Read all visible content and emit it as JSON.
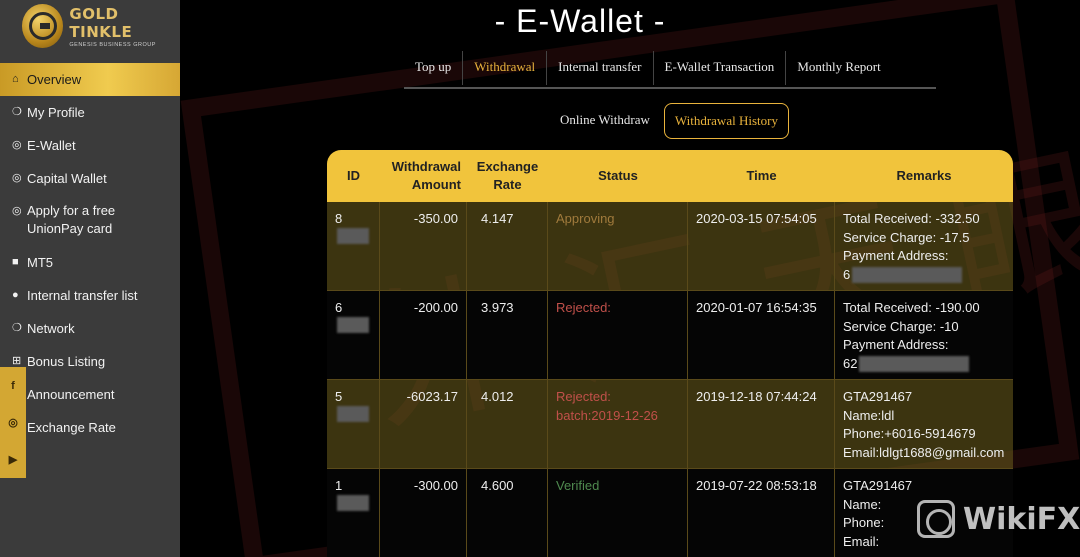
{
  "brand": {
    "name": "GOLD TINKLE",
    "tagline": "GENESIS BUSINESS GROUP"
  },
  "sidebar": {
    "items": [
      {
        "icon": "home-icon",
        "glyph": "⌂",
        "label": "Overview",
        "active": true
      },
      {
        "icon": "profile-icon",
        "glyph": "❍",
        "label": "My Profile"
      },
      {
        "icon": "wallet-icon",
        "glyph": "◎",
        "label": "E-Wallet"
      },
      {
        "icon": "capital-icon",
        "glyph": "◎",
        "label": "Capital Wallet"
      },
      {
        "icon": "card-icon",
        "glyph": "◎",
        "label": "Apply for a free UnionPay card"
      },
      {
        "icon": "mt5-icon",
        "glyph": "■",
        "label": "MT5"
      },
      {
        "icon": "transfer-icon",
        "glyph": "●",
        "label": "Internal transfer list"
      },
      {
        "icon": "network-icon",
        "glyph": "❍",
        "label": "Network"
      },
      {
        "icon": "bonus-icon",
        "glyph": "⊞",
        "label": "Bonus Listing"
      },
      {
        "icon": "announcement-icon",
        "glyph": "",
        "label": "Announcement"
      },
      {
        "icon": "exchange-icon",
        "glyph": "",
        "label": "Exchange Rate"
      }
    ],
    "social": [
      {
        "icon": "facebook-icon",
        "glyph": "f"
      },
      {
        "icon": "instagram-icon",
        "glyph": "◎"
      },
      {
        "icon": "youtube-icon",
        "glyph": "▶"
      }
    ]
  },
  "page": {
    "title": "- E-Wallet -"
  },
  "tabs": [
    {
      "label": "Top up"
    },
    {
      "label": "Withdrawal",
      "active": true
    },
    {
      "label": "Internal transfer"
    },
    {
      "label": "E-Wallet Transaction"
    },
    {
      "label": "Monthly Report"
    }
  ],
  "subtabs": [
    {
      "label": "Online Withdraw"
    },
    {
      "label": "Withdrawal History",
      "active": true
    }
  ],
  "table": {
    "headers": [
      "ID",
      "Withdrawal Amount",
      "Exchange Rate",
      "Status",
      "Time",
      "Remarks"
    ],
    "rows": [
      {
        "id": "8",
        "amount": "-350.00",
        "rate": "4.147",
        "status": "Approving",
        "status_type": "approving",
        "time": "2020-03-15 07:54:05",
        "remarks": [
          "Total Received: -332.50",
          "Service Charge: -17.5",
          "Payment Address:",
          "6"
        ]
      },
      {
        "id": "6",
        "amount": "-200.00",
        "rate": "3.973",
        "status": "Rejected:",
        "status_type": "rejected",
        "time": "2020-01-07 16:54:35",
        "remarks": [
          "Total Received: -190.00",
          "Service Charge: -10",
          "Payment Address:",
          "62"
        ]
      },
      {
        "id": "5",
        "amount": "-6023.17",
        "rate": "4.012",
        "status": "Rejected: batch:2019-12-26",
        "status_type": "rejected",
        "time": "2019-12-18 07:44:24",
        "remarks": [
          "GTA291467",
          "Name:ldl",
          "Phone:+6016-5914679",
          "Email:ldlgt1688@gmail.com"
        ]
      },
      {
        "id": "1",
        "amount": "-300.00",
        "rate": "4.600",
        "status": "Verified",
        "status_type": "verified",
        "time": "2019-07-22 08:53:18",
        "remarks": [
          "GTA291467",
          "Name:",
          "Phone:",
          "Email:"
        ]
      }
    ]
  },
  "watermark": {
    "text": "WikiFX"
  },
  "colors": {
    "accent": "#f1c43c",
    "sidebar": "#3b3b3b",
    "rejected": "#c0504a",
    "verified": "#4f8a4f",
    "approving": "#a07a3c"
  }
}
